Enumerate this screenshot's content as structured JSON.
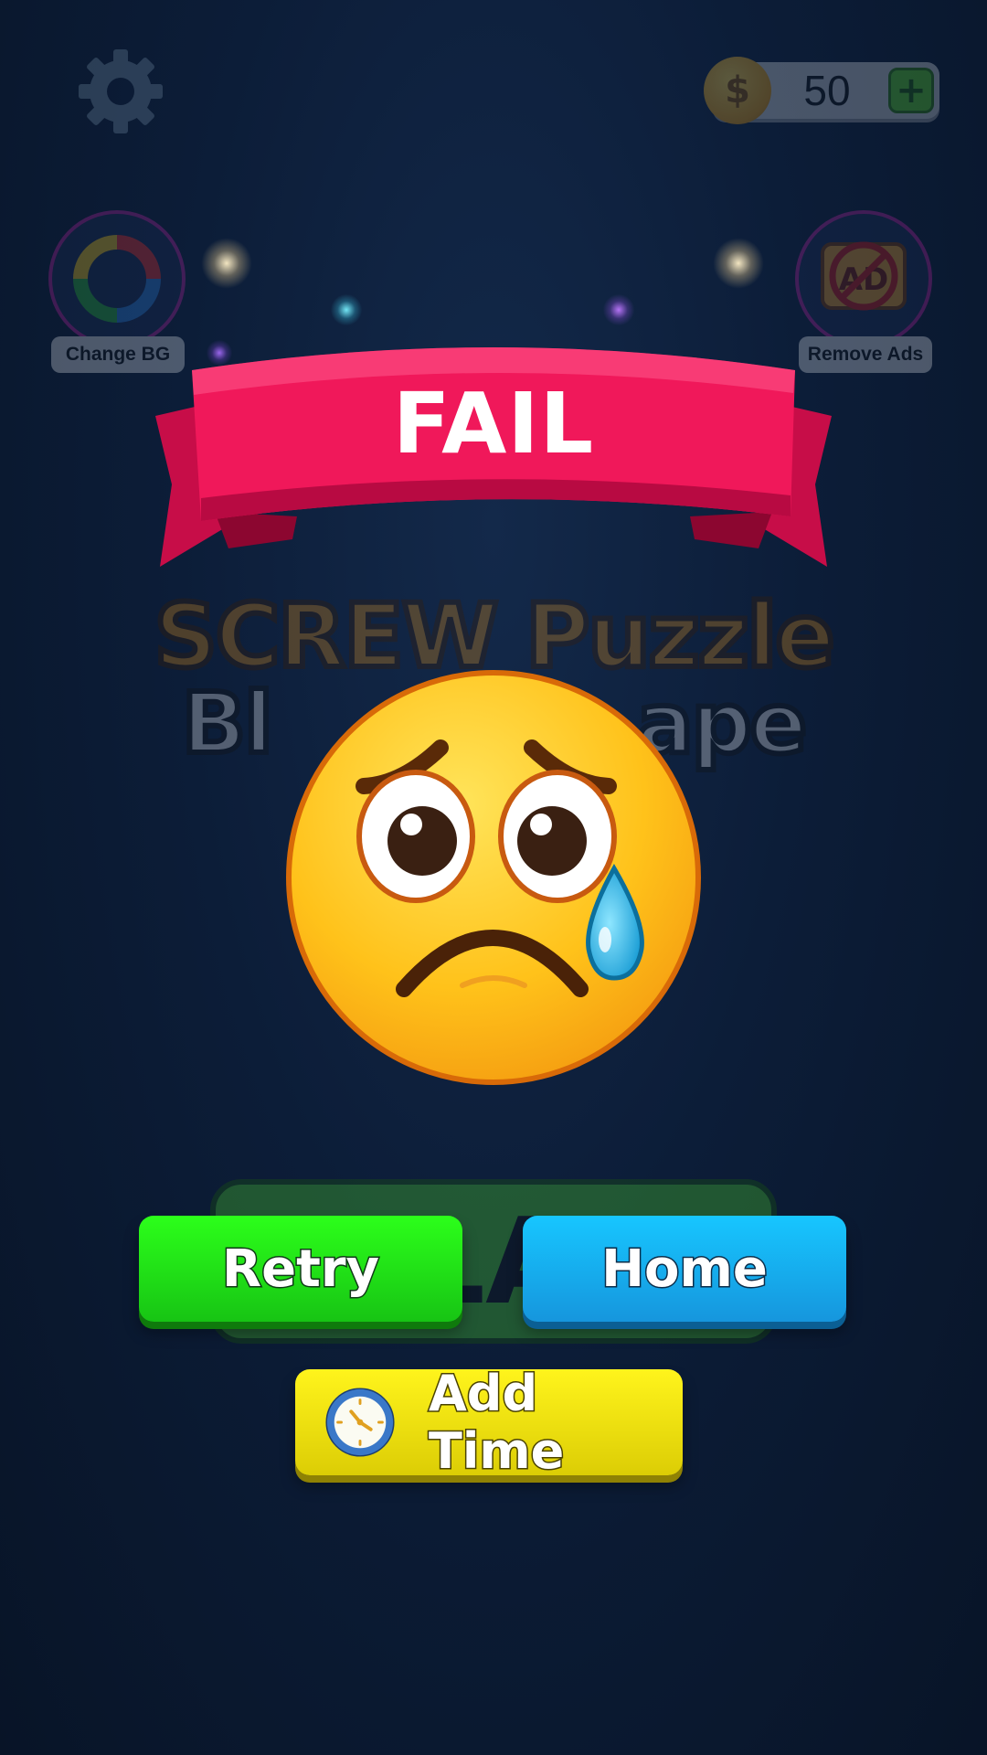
{
  "background": {
    "coins": {
      "count": "50",
      "coin_symbol": "$",
      "plus_symbol": "+"
    },
    "change_bg": {
      "label": "Change BG"
    },
    "remove_ads": {
      "label": "Remove Ads",
      "icon_text": "AD"
    },
    "logo": {
      "line1": "SCREW Puzzle",
      "line2_left": "Bl",
      "line2_right": "ape"
    },
    "play": {
      "label": "LA"
    }
  },
  "dialog": {
    "title": "FAIL",
    "emoji": "crying-face-icon",
    "retry_label": "Retry",
    "home_label": "Home",
    "add_time_label": "Add Time"
  },
  "colors": {
    "ribbon": "#f0185a",
    "retry": "#22e014",
    "home": "#12b4f0",
    "add_time": "#f2e40f"
  }
}
